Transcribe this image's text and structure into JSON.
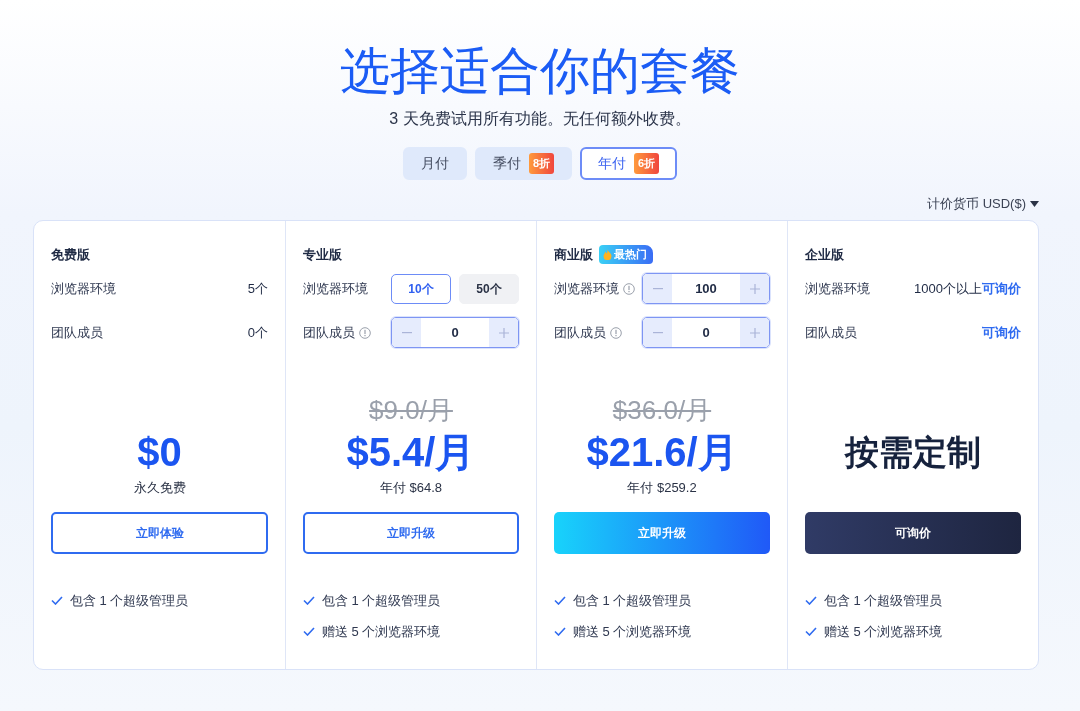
{
  "title": "选择适合你的套餐",
  "subtitle": "3 天免费试用所有功能。无任何额外收费。",
  "billing_tabs": [
    {
      "label": "月付",
      "selected": false
    },
    {
      "label": "季付",
      "discount": "8折",
      "selected": false
    },
    {
      "label": "年付",
      "discount": "6折",
      "selected": true
    }
  ],
  "currency": {
    "label": "计价货币 USD($)"
  },
  "plans": [
    {
      "name": "免费版",
      "rows": [
        {
          "label": "浏览器环境",
          "kind": "text",
          "value": "5个"
        },
        {
          "label": "团队成员",
          "kind": "text",
          "value": "0个"
        }
      ],
      "price": "$0",
      "kind": "amount",
      "price_note": "永久免费",
      "button": {
        "label": "立即体验",
        "kind": "outline"
      },
      "features": [
        "包含 1 个超级管理员"
      ]
    },
    {
      "name": "专业版",
      "rows": [
        {
          "label": "浏览器环境",
          "kind": "choice",
          "options": [
            {
              "label": "10个",
              "selected": true
            },
            {
              "label": "50个",
              "selected": false
            }
          ]
        },
        {
          "label": "团队成员",
          "info": true,
          "kind": "stepper",
          "value": "0"
        }
      ],
      "old_price": "$9.0/月",
      "price": "$5.4/月",
      "kind": "amount",
      "price_note": "年付 $64.8",
      "button": {
        "label": "立即升级",
        "kind": "outline"
      },
      "features": [
        "包含 1 个超级管理员",
        "赠送 5 个浏览器环境"
      ]
    },
    {
      "name": "商业版",
      "badge": "最热门",
      "rows": [
        {
          "label": "浏览器环境",
          "info": true,
          "kind": "stepper",
          "value": "100"
        },
        {
          "label": "团队成员",
          "info": true,
          "kind": "stepper",
          "value": "0"
        }
      ],
      "old_price": "$36.0/月",
      "price": "$21.6/月",
      "kind": "amount",
      "price_note": "年付 $259.2",
      "button": {
        "label": "立即升级",
        "kind": "gradient"
      },
      "features": [
        "包含 1 个超级管理员",
        "赠送 5 个浏览器环境"
      ]
    },
    {
      "name": "企业版",
      "rows": [
        {
          "label": "浏览器环境",
          "kind": "text",
          "value": "1000个以上",
          "link": "可询价"
        },
        {
          "label": "团队成员",
          "kind": "text",
          "link": "可询价"
        }
      ],
      "price": "按需定制",
      "kind": "custom",
      "button": {
        "label": "可询价",
        "kind": "dark"
      },
      "features": [
        "包含 1 个超级管理员",
        "赠送 5 个浏览器环境"
      ]
    }
  ]
}
